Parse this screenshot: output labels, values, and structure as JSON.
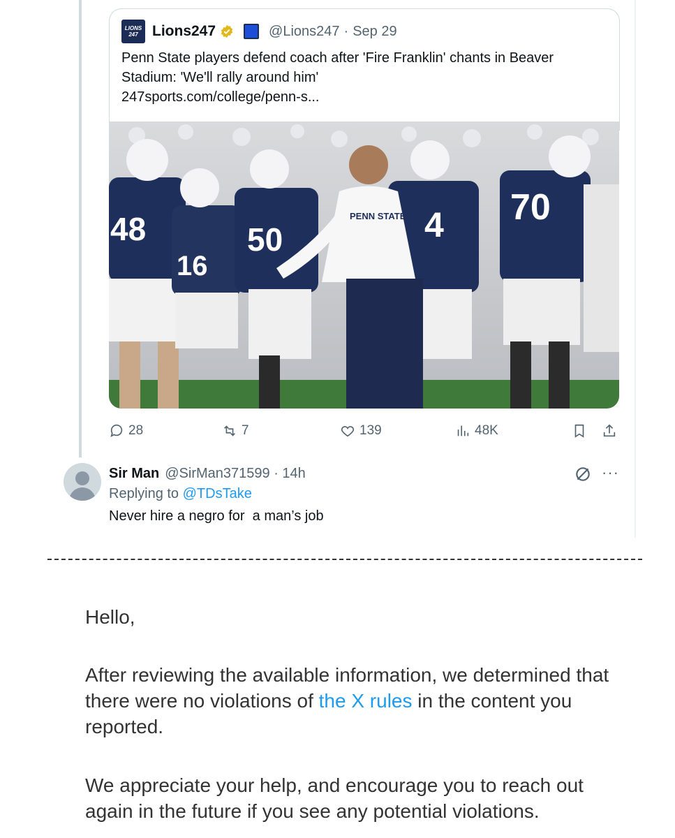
{
  "quoted_post": {
    "logo_text_top": "LIONS",
    "logo_text_bottom": "247",
    "name": "Lions247",
    "handle": "@Lions247",
    "date": "Sep 29",
    "headline": "Penn State players defend coach after 'Fire Franklin' chants in Beaver Stadium: 'We'll rally around him'",
    "link": "247sports.com/college/penn-s...",
    "photo_jersey_numbers": [
      "48",
      "16",
      "50",
      "4",
      "70"
    ],
    "photo_shirt_text": "PENN STATE"
  },
  "actions": {
    "replies": "28",
    "reposts": "7",
    "likes": "139",
    "views": "48K"
  },
  "reply_post": {
    "name": "Sir Man",
    "handle": "@SirMan371599",
    "time": "14h",
    "replying_prefix": "Replying to",
    "replying_to": "@TDsTake",
    "text": "Never hire a negro for  a man’s job"
  },
  "email": {
    "greeting": "Hello,",
    "p1_before": "After reviewing the available information, we determined that there were no violations of",
    "p1_link": "the X rules",
    "p1_after": "in the content you reported.",
    "p2": "We appreciate your help, and encourage you to reach out again in the future if you see any potential violations."
  },
  "colors": {
    "accent": "#1d9bf0",
    "muted": "#536471",
    "verified_gold": "#e2b719",
    "navy": "#1b2c57"
  }
}
